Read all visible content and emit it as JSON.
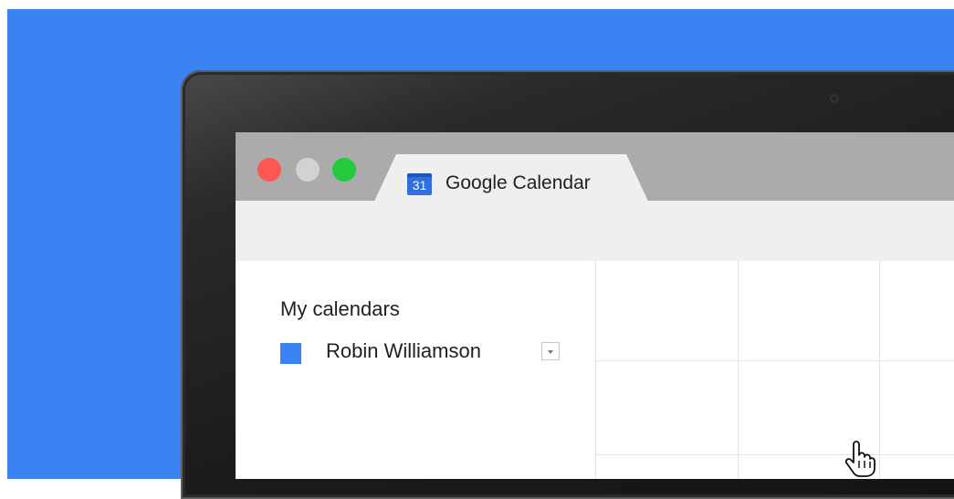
{
  "window": {
    "controls": {
      "close_color": "#fc5753",
      "minimize_color": "#d2d2d2",
      "zoom_color": "#24c93e"
    },
    "tab": {
      "icon": "google-calendar-icon",
      "icon_text": "31",
      "title": "Google Calendar"
    }
  },
  "sidebar": {
    "section_title": "My calendars",
    "calendars": [
      {
        "name": "Robin Williamson",
        "color": "#3b82f2",
        "menu_icon": "dropdown-arrow-icon"
      }
    ]
  },
  "colors": {
    "background": "#3b82f2",
    "accent": "#3b82f2",
    "tab_bar": "#ababab",
    "toolbar": "#efefef"
  },
  "cursor": {
    "icon": "hand-pointer-icon"
  }
}
